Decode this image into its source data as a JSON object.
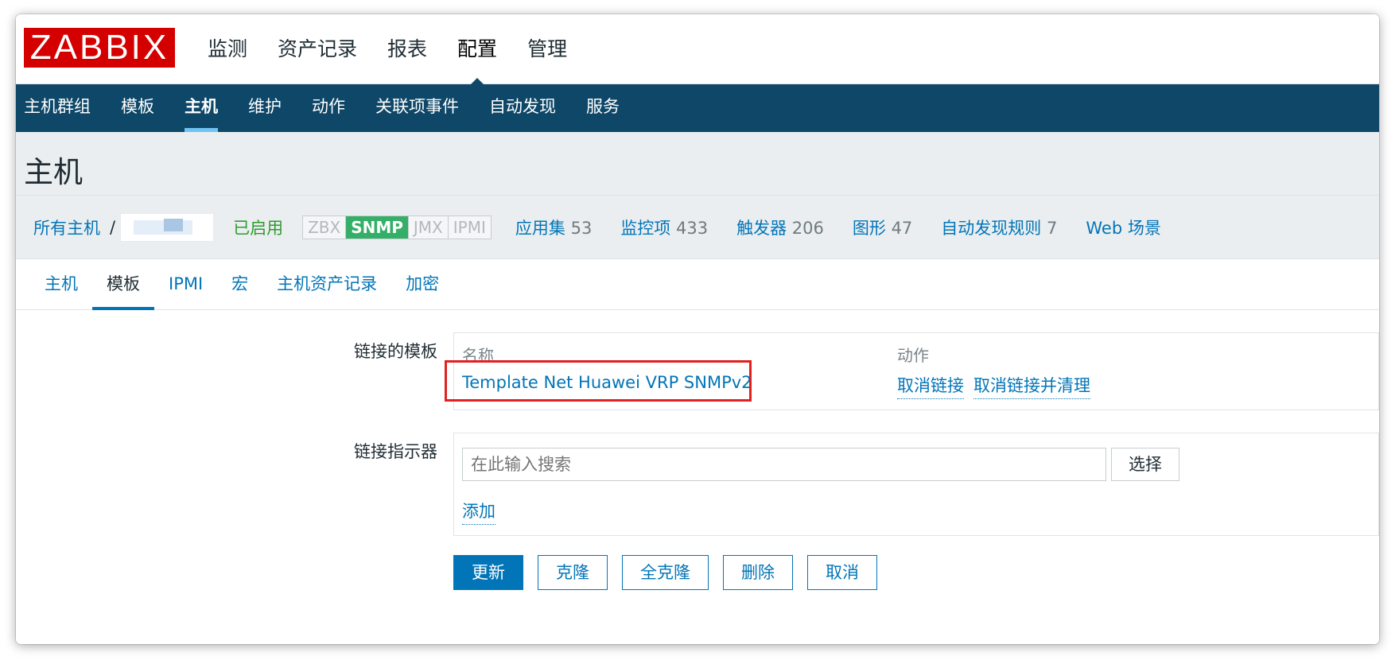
{
  "app": {
    "logo": "ZABBIX"
  },
  "topnav": [
    {
      "label": "监测"
    },
    {
      "label": "资产记录"
    },
    {
      "label": "报表"
    },
    {
      "label": "配置"
    },
    {
      "label": "管理"
    }
  ],
  "subnav": [
    {
      "label": "主机群组"
    },
    {
      "label": "模板"
    },
    {
      "label": "主机"
    },
    {
      "label": "维护"
    },
    {
      "label": "动作"
    },
    {
      "label": "关联项事件"
    },
    {
      "label": "自动发现"
    },
    {
      "label": "服务"
    }
  ],
  "page": {
    "title": "主机"
  },
  "hostbar": {
    "all_hosts": "所有主机",
    "sep": "/",
    "status": "已启用",
    "availability": [
      "ZBX",
      "SNMP",
      "JMX",
      "IPMI"
    ],
    "links": [
      {
        "label": "应用集",
        "count": "53"
      },
      {
        "label": "监控项",
        "count": "433"
      },
      {
        "label": "触发器",
        "count": "206"
      },
      {
        "label": "图形",
        "count": "47"
      },
      {
        "label": "自动发现规则",
        "count": "7"
      },
      {
        "label": "Web 场景",
        "count": ""
      }
    ]
  },
  "tabs": [
    {
      "label": "主机"
    },
    {
      "label": "模板"
    },
    {
      "label": "IPMI"
    },
    {
      "label": "宏"
    },
    {
      "label": "主机资产记录"
    },
    {
      "label": "加密"
    }
  ],
  "form": {
    "linked_templates_label": "链接的模板",
    "col_name": "名称",
    "col_action": "动作",
    "template_name": "Template Net Huawei VRP SNMPv2",
    "unlink": "取消链接",
    "unlink_clear": "取消链接并清理",
    "link_indicator_label": "链接指示器",
    "search_placeholder": "在此输入搜索",
    "select_button": "选择",
    "add_link": "添加"
  },
  "buttons": {
    "update": "更新",
    "clone": "克隆",
    "full_clone": "全克隆",
    "delete": "删除",
    "cancel": "取消"
  },
  "colors": {
    "nav_bg": "#0e4768",
    "logo_red": "#d40000",
    "link_blue": "#0275b8",
    "snmp_green": "#34af67",
    "highlight_red": "#e1201f"
  }
}
